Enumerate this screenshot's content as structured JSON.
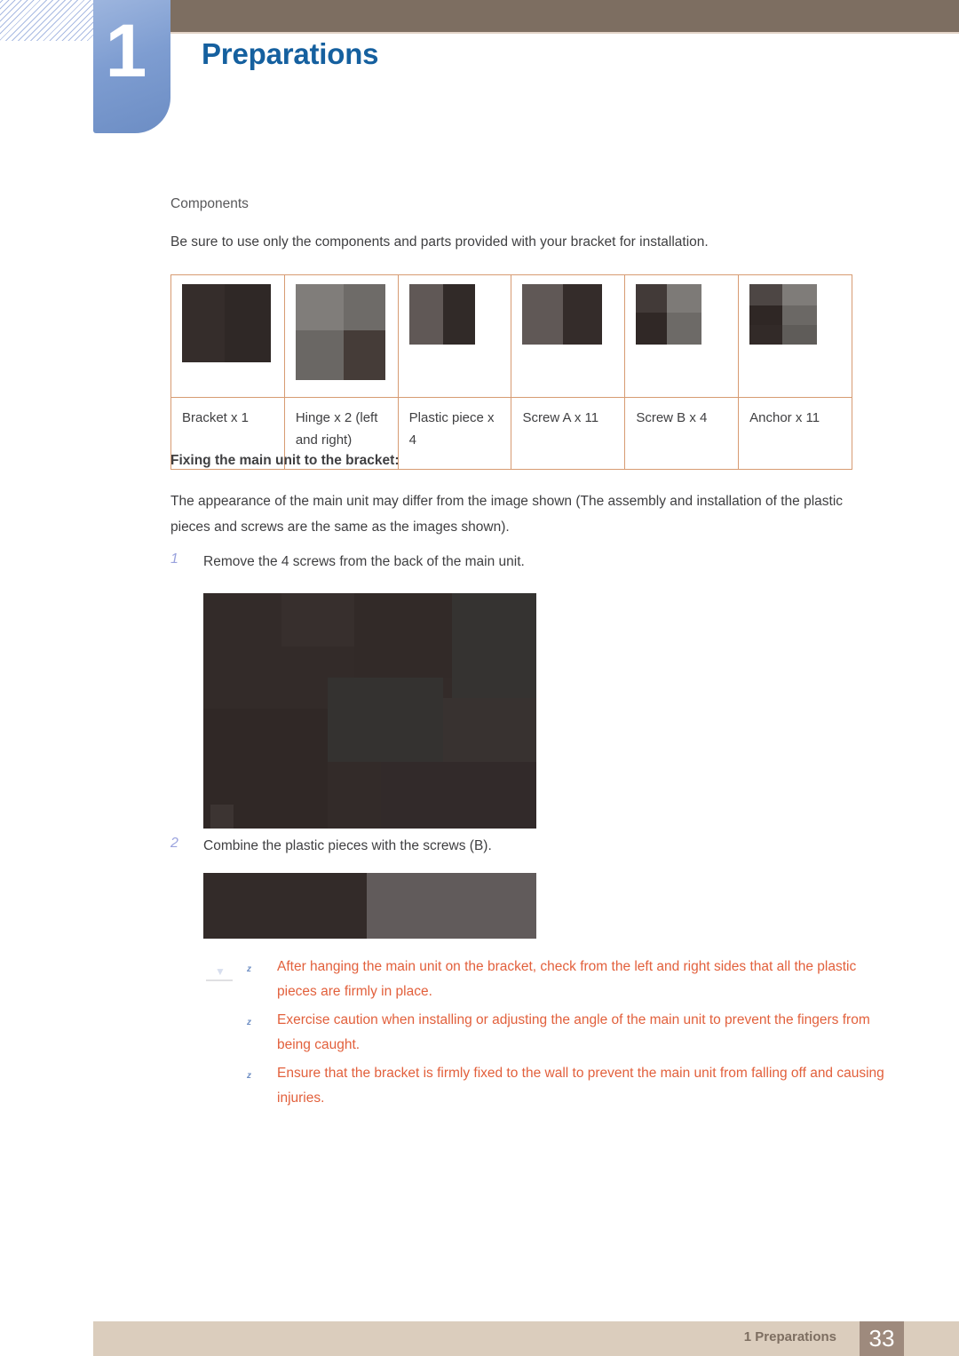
{
  "chapter": {
    "number": "1",
    "title": "Preparations"
  },
  "section": {
    "heading": "Components",
    "intro": "Be sure to use only the components and parts provided with your bracket for installation."
  },
  "components_table": {
    "rows": [
      {
        "label": "Bracket x 1",
        "image_name": "bracket-image"
      },
      {
        "label": "Hinge x 2 (left and right)",
        "image_name": "hinge-image"
      },
      {
        "label": "Plastic piece x 4",
        "image_name": "plastic-piece-image"
      },
      {
        "label": "Screw A x 11",
        "image_name": "screw-a-image"
      },
      {
        "label": "Screw B x 4",
        "image_name": "screw-b-image"
      },
      {
        "label": "Anchor x 11",
        "image_name": "anchor-image"
      }
    ]
  },
  "procedure": {
    "heading": "Fixing the main unit to the bracket:",
    "note": "The appearance of the main unit may differ from the image shown (The assembly and installation of the plastic pieces and screws are the same as the images shown).",
    "steps": [
      {
        "number": "1",
        "text": "Remove the 4 screws from the back of the main unit."
      },
      {
        "number": "2",
        "text": "Combine the plastic pieces with the screws (B)."
      }
    ]
  },
  "cautions": {
    "bullet_glyph": "z",
    "items": [
      "After hanging the main unit on the bracket, check from the left and right sides that all the plastic pieces are firmly in place.",
      "Exercise caution when installing or adjusting the angle of the main unit to prevent the fingers from being caught.",
      "Ensure that the bracket is firmly fixed to the wall to prevent the main unit from falling off and causing injuries."
    ]
  },
  "footer": {
    "text": "1 Preparations",
    "page_number": "33"
  },
  "colors": {
    "title_blue": "#15609f",
    "top_bar_brown": "#7d6e61",
    "tab_blue": "#7e9dd1",
    "table_border": "#d79b72",
    "caution_red": "#e2603c",
    "footer_bar": "#dbcdbd",
    "footer_page_box": "#9e8a7d",
    "step_number_blue": "#9aa3de"
  }
}
